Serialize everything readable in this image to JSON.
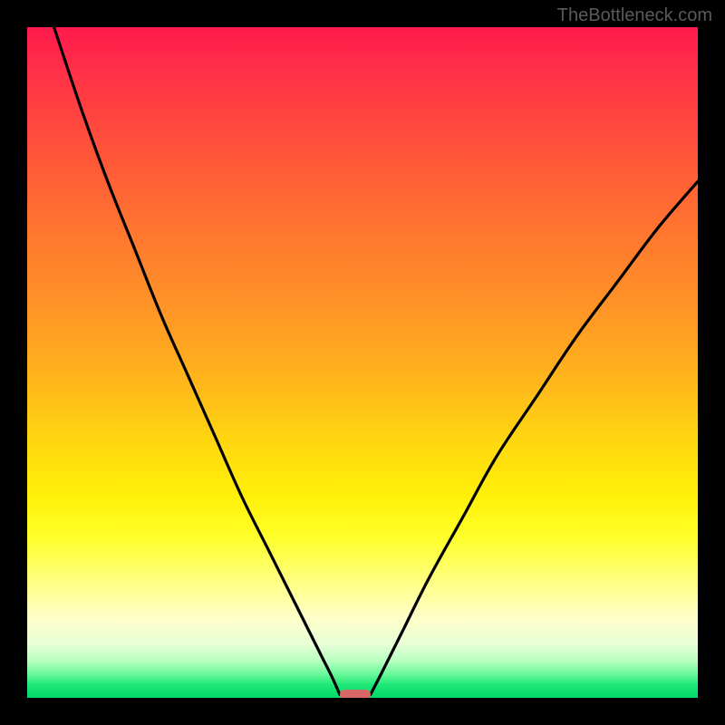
{
  "watermark": "TheBottleneck.com",
  "chart_data": {
    "type": "line",
    "title": "",
    "xlabel": "",
    "ylabel": "",
    "xlim": [
      0,
      100
    ],
    "ylim": [
      0,
      100
    ],
    "grid": false,
    "series": [
      {
        "name": "left-curve",
        "x": [
          4,
          8,
          12,
          16,
          20,
          24,
          28,
          32,
          36,
          40,
          42,
          44,
          45.5,
          46.6
        ],
        "y": [
          100,
          88,
          77,
          67,
          57,
          48,
          39,
          30,
          22,
          14,
          10,
          6,
          3,
          0.5
        ]
      },
      {
        "name": "right-curve",
        "x": [
          51.2,
          53,
          56,
          60,
          65,
          70,
          76,
          82,
          88,
          94,
          100
        ],
        "y": [
          0.5,
          4,
          10,
          18,
          27,
          36,
          45,
          54,
          62,
          70,
          77
        ]
      }
    ],
    "background_gradient": {
      "top_color": "#ff1a4d",
      "bottom_color": "#00d868",
      "stops": [
        "red",
        "orange",
        "yellow",
        "pale-yellow",
        "green"
      ]
    },
    "marker": {
      "name": "bottleneck-marker",
      "x_center": 48.9,
      "y": 0.5,
      "width_pct": 4.6,
      "color": "#d86868"
    }
  }
}
